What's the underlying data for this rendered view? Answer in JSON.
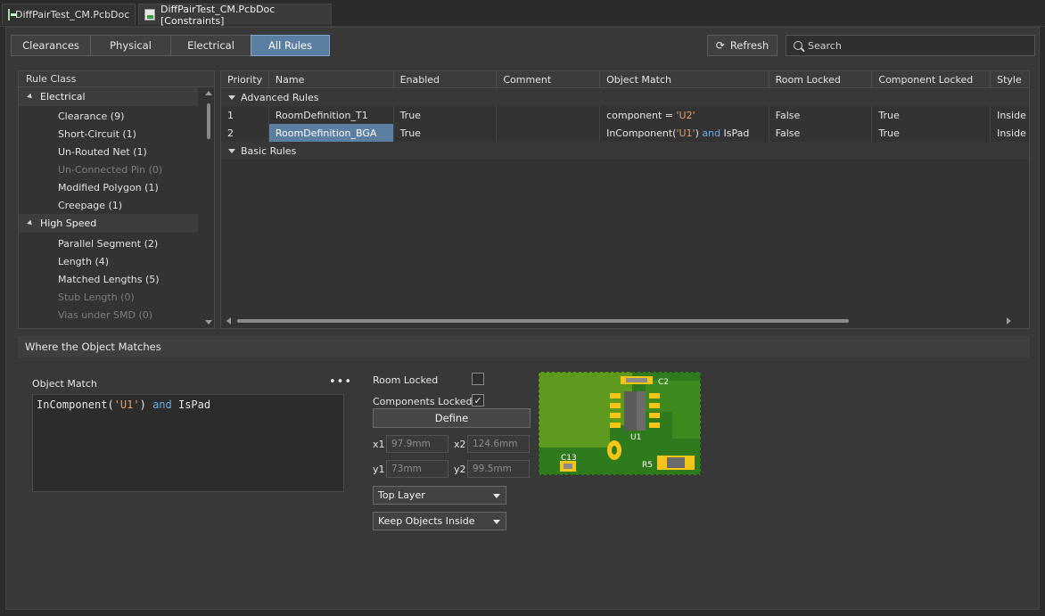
{
  "doc_tabs": [
    {
      "label": "DiffPairTest_CM.PcbDoc",
      "active": false
    },
    {
      "label": "DiffPairTest_CM.PcbDoc [Constraints]",
      "active": true
    }
  ],
  "view_tabs": [
    {
      "label": "Clearances",
      "active": false
    },
    {
      "label": "Physical",
      "active": false
    },
    {
      "label": "Electrical",
      "active": false
    },
    {
      "label": "All Rules",
      "active": true
    }
  ],
  "toolbar": {
    "refresh_label": "Refresh",
    "search_placeholder": "Search"
  },
  "rule_class": {
    "header": "Rule Class",
    "groups": [
      {
        "label": "Electrical",
        "items": [
          {
            "label": "Clearance (9)",
            "dim": false
          },
          {
            "label": "Short-Circuit (1)",
            "dim": false
          },
          {
            "label": "Un-Routed Net (1)",
            "dim": false
          },
          {
            "label": "Un-Connected Pin (0)",
            "dim": true
          },
          {
            "label": "Modified Polygon (1)",
            "dim": false
          },
          {
            "label": "Creepage (1)",
            "dim": false
          }
        ]
      },
      {
        "label": "High Speed",
        "items": [
          {
            "label": "Parallel Segment (2)",
            "dim": false
          },
          {
            "label": "Length (4)",
            "dim": false
          },
          {
            "label": "Matched Lengths (5)",
            "dim": false
          },
          {
            "label": "Stub Length (0)",
            "dim": true
          },
          {
            "label": "Vias under SMD (0)",
            "dim": true
          }
        ]
      }
    ]
  },
  "grid": {
    "columns": [
      "Priority",
      "Name",
      "Enabled",
      "Comment",
      "Object Match",
      "Room Locked",
      "Component Locked",
      "Style"
    ],
    "groups": [
      {
        "label": "Advanced Rules",
        "rows": [
          {
            "priority": "1",
            "name": "RoomDefinition_T1",
            "enabled": "True",
            "comment": "",
            "match": [
              {
                "t": "component = ",
                "c": ""
              },
              {
                "t": "'U2'",
                "c": "q"
              }
            ],
            "room_locked": "False",
            "component_locked": "True",
            "style": "Inside",
            "selected": false
          },
          {
            "priority": "2",
            "name": "RoomDefinition_BGA",
            "enabled": "True",
            "comment": "",
            "match": [
              {
                "t": "InComponent(",
                "c": ""
              },
              {
                "t": "'U1'",
                "c": "q"
              },
              {
                "t": ") ",
                "c": ""
              },
              {
                "t": "and",
                "c": "kw"
              },
              {
                "t": " IsPad",
                "c": ""
              }
            ],
            "room_locked": "False",
            "component_locked": "True",
            "style": "Inside",
            "selected": true
          }
        ]
      },
      {
        "label": "Basic Rules",
        "rows": []
      }
    ]
  },
  "where": {
    "header": "Where the Object Matches",
    "object_match_label": "Object Match",
    "more_label": "•••",
    "query": [
      {
        "t": "InComponent(",
        "c": ""
      },
      {
        "t": "'U1'",
        "c": "q"
      },
      {
        "t": ") ",
        "c": ""
      },
      {
        "t": "and",
        "c": "kw"
      },
      {
        "t": " IsPad",
        "c": ""
      }
    ],
    "room_locked_label": "Room Locked",
    "room_locked": false,
    "components_locked_label": "Components Locked",
    "components_locked": true,
    "define_label": "Define",
    "x1_label": "x1",
    "x1": "97.9mm",
    "x2_label": "x2",
    "x2": "124.6mm",
    "y1_label": "y1",
    "y1": "73mm",
    "y2_label": "y2",
    "y2": "99.5mm",
    "layer": "Top Layer",
    "confinement": "Keep Objects Inside",
    "preview_labels": {
      "c2": "C2",
      "u1": "U1",
      "c13": "C13",
      "r5": "R5"
    }
  },
  "colors": {
    "accent": "#5b7ea3",
    "board": "#5e9a1e",
    "pad": "#f5c518",
    "quote": "#e7a06a",
    "keyword": "#6aa9e8"
  }
}
